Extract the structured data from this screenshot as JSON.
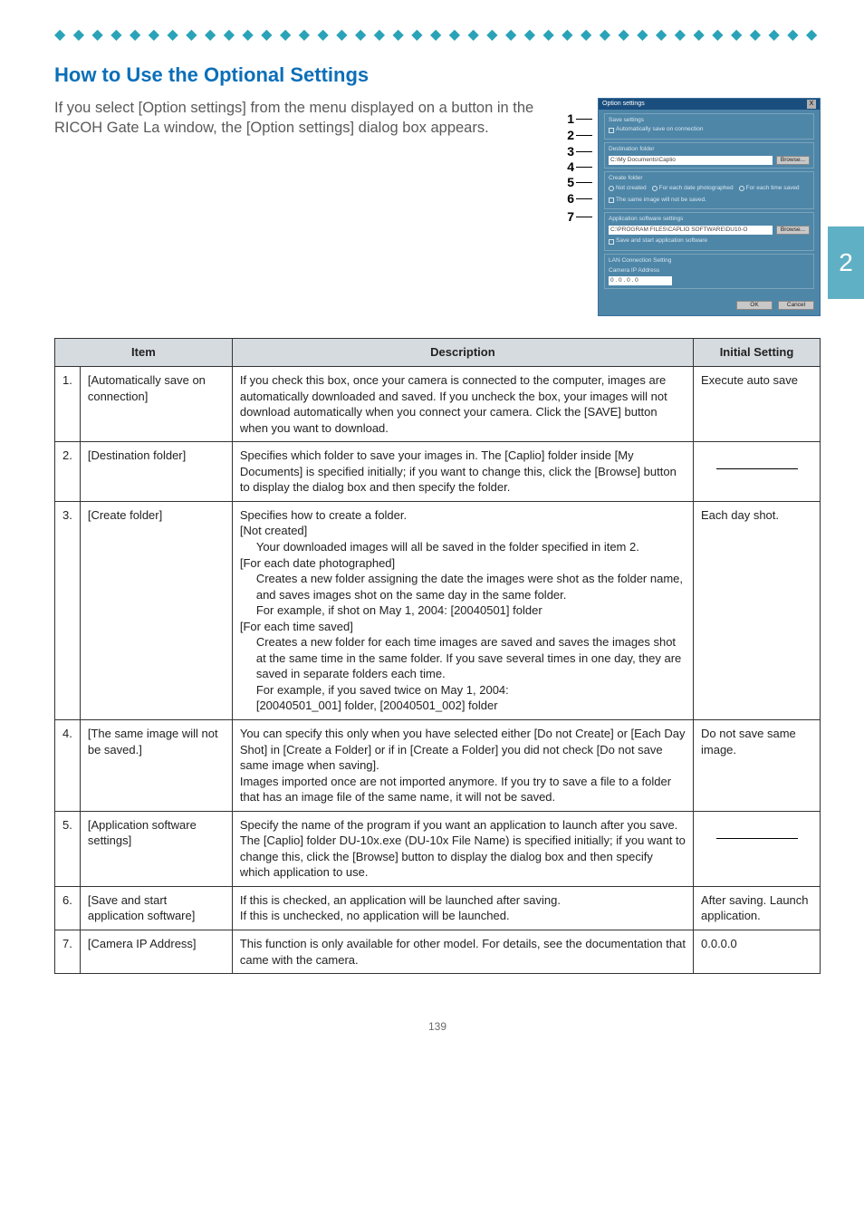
{
  "section_title": "How to Use the Optional Settings",
  "intro_text": "If you select [Option settings] from the menu displayed on a button in the RICOH Gate La window, the [Option settings] dialog box appears.",
  "chapter_number": "2",
  "page_number": "139",
  "dialog": {
    "title": "Option settings",
    "close": "X",
    "groups": {
      "save": {
        "label": "Save settings",
        "checkbox": "Automatically save on connection"
      },
      "dest": {
        "label": "Destination folder",
        "value": "C:\\My Documents\\Caplio",
        "browse": "Browse..."
      },
      "create": {
        "label": "Create folder",
        "r1": "Not created",
        "r2": "For each date photographed",
        "r3": "For each time saved",
        "check": "The same image will not be saved."
      },
      "app": {
        "label": "Application software settings",
        "value": "C:\\PROGRAM FILES\\CAPLIO SOFTWARE\\DU10-O",
        "browse": "Browse...",
        "check": "Save and start application software"
      },
      "lan": {
        "label": "LAN Connection Setting",
        "sub": "Camera IP Address",
        "ip": "0 . 0 . 0 . 0"
      }
    },
    "ok": "OK",
    "cancel": "Cancel",
    "callouts": [
      "1",
      "2",
      "3",
      "4",
      "5",
      "6",
      "7"
    ]
  },
  "table": {
    "headers": {
      "item": "Item",
      "description": "Description",
      "initial": "Initial Setting"
    },
    "rows": [
      {
        "num": "1.",
        "item": "[Automatically save on connection]",
        "desc_lines": [
          [
            "p",
            "If you check this box, once your camera is connected to the computer, images are automatically downloaded and saved. If you uncheck the box, your images will not download automatically when you connect your camera. Click the [SAVE] button when you want to download."
          ]
        ],
        "initial_type": "text",
        "initial": "Execute auto save"
      },
      {
        "num": "2.",
        "item": "[Destination folder]",
        "desc_lines": [
          [
            "p",
            "Specifies which folder to save your images in. The [Caplio] folder inside [My Documents] is specified initially; if you want to change this, click the [Browse] button to display the dialog box and then specify the folder."
          ]
        ],
        "initial_type": "underline",
        "initial": ""
      },
      {
        "num": "3.",
        "item": "[Create folder]",
        "desc_lines": [
          [
            "p",
            "Specifies how to create a folder."
          ],
          [
            "p",
            "[Not created]"
          ],
          [
            "i1",
            "Your downloaded images will all be saved in the folder specified in item 2."
          ],
          [
            "p",
            "[For each date photographed]"
          ],
          [
            "i1",
            "Creates a new folder assigning the date the images were shot as the folder name, and saves images shot on the same day in the same folder."
          ],
          [
            "i1",
            "For example, if shot on May 1, 2004: [20040501] folder"
          ],
          [
            "p",
            "[For each time saved]"
          ],
          [
            "i1",
            "Creates a new folder for each time images are saved and saves the images shot at the same time in the same folder. If you save several times in one day, they are saved in separate folders each time."
          ],
          [
            "i1",
            "For example, if you saved twice on May 1, 2004:"
          ],
          [
            "i1",
            "[20040501_001] folder, [20040501_002] folder"
          ]
        ],
        "initial_type": "text",
        "initial": "Each day shot."
      },
      {
        "num": "4.",
        "item": "[The same image will not be saved.]",
        "desc_lines": [
          [
            "p",
            "You can specify this only when you have selected either [Do not Create] or [Each Day Shot] in [Create a Folder] or if in [Create a Folder] you did not check [Do not save same image when saving]."
          ],
          [
            "p",
            "Images imported once are not imported anymore. If you try to save a file to a folder that has an image file of the same name, it will not be saved."
          ]
        ],
        "initial_type": "text",
        "initial": "Do not save same image."
      },
      {
        "num": "5.",
        "item": "[Application software settings]",
        "desc_lines": [
          [
            "p",
            "Specify the name of the program if you want an application to launch after you save. The [Caplio] folder DU-10x.exe (DU-10x File Name) is specified initially; if you want to change this, click the [Browse] button to display the dialog box and then specify which application to use."
          ]
        ],
        "initial_type": "underline",
        "initial": ""
      },
      {
        "num": "6.",
        "item": "[Save and start application software]",
        "desc_lines": [
          [
            "p",
            "If this is checked, an application will be launched after saving."
          ],
          [
            "p",
            "If this is unchecked, no application will be launched."
          ]
        ],
        "initial_type": "text",
        "initial": "After saving. Launch application."
      },
      {
        "num": "7.",
        "item": "[Camera IP Address]",
        "desc_lines": [
          [
            "p",
            "This function is only available for other model. For details, see the documentation that came with the camera."
          ]
        ],
        "initial_type": "text",
        "initial": "0.0.0.0"
      }
    ]
  }
}
